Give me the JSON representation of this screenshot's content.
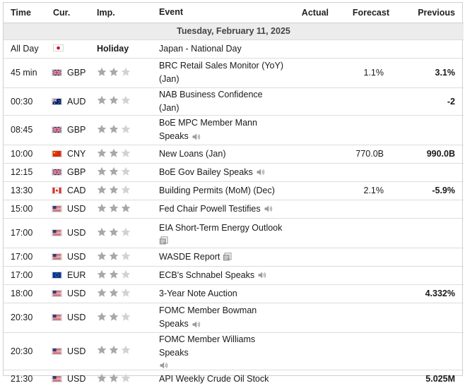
{
  "headers": {
    "time": "Time",
    "cur": "Cur.",
    "imp": "Imp.",
    "event": "Event",
    "actual": "Actual",
    "forecast": "Forecast",
    "previous": "Previous"
  },
  "date": "Tuesday, February 11, 2025",
  "holiday": {
    "time": "All Day",
    "flag": "jp",
    "label": "Holiday",
    "event": "Japan - National Day"
  },
  "colors": {
    "star_on": "#a8a8a8",
    "star_off": "#d2d2d2",
    "border": "#dcdcdc",
    "date_bg": "#ececec"
  },
  "rows": [
    {
      "time": "45 min",
      "flag": "gb",
      "cur": "GBP",
      "stars": 2,
      "event_l1": "BRC Retail Sales Monitor (YoY)",
      "event_l2": "(Jan)",
      "icon": "",
      "actual": "",
      "forecast": "1.1%",
      "previous": "3.1%"
    },
    {
      "time": "00:30",
      "flag": "au",
      "cur": "AUD",
      "stars": 2,
      "event_l1": "NAB Business Confidence (Jan)",
      "event_l2": "",
      "icon": "",
      "actual": "",
      "forecast": "",
      "previous": "-2"
    },
    {
      "time": "08:45",
      "flag": "gb",
      "cur": "GBP",
      "stars": 2,
      "event_l1": "BoE MPC Member Mann",
      "event_l2": "Speaks",
      "icon": "speaker-icon",
      "actual": "",
      "forecast": "",
      "previous": ""
    },
    {
      "time": "10:00",
      "flag": "cn",
      "cur": "CNY",
      "stars": 2,
      "event_l1": "New Loans (Jan)",
      "event_l2": "",
      "icon": "",
      "actual": "",
      "forecast": "770.0B",
      "previous": "990.0B"
    },
    {
      "time": "12:15",
      "flag": "gb",
      "cur": "GBP",
      "stars": 2,
      "event_l1": "BoE Gov Bailey Speaks",
      "event_l2": "",
      "icon": "speaker-icon",
      "actual": "",
      "forecast": "",
      "previous": ""
    },
    {
      "time": "13:30",
      "flag": "ca",
      "cur": "CAD",
      "stars": 2,
      "event_l1": "Building Permits (MoM) (Dec)",
      "event_l2": "",
      "icon": "",
      "actual": "",
      "forecast": "2.1%",
      "previous": "-5.9%"
    },
    {
      "time": "15:00",
      "flag": "us",
      "cur": "USD",
      "stars": 3,
      "event_l1": "Fed Chair Powell Testifies",
      "event_l2": "",
      "icon": "speaker-icon",
      "actual": "",
      "forecast": "",
      "previous": ""
    },
    {
      "time": "17:00",
      "flag": "us",
      "cur": "USD",
      "stars": 2,
      "event_l1": "EIA Short-Term Energy Outlook",
      "event_l2": "",
      "icon": "report-icon",
      "actual": "",
      "forecast": "",
      "previous": ""
    },
    {
      "time": "17:00",
      "flag": "us",
      "cur": "USD",
      "stars": 2,
      "event_l1": "WASDE Report",
      "event_l2": "",
      "icon": "report-icon",
      "actual": "",
      "forecast": "",
      "previous": ""
    },
    {
      "time": "17:00",
      "flag": "eu",
      "cur": "EUR",
      "stars": 2,
      "event_l1": "ECB's Schnabel Speaks",
      "event_l2": "",
      "icon": "speaker-icon",
      "actual": "",
      "forecast": "",
      "previous": ""
    },
    {
      "time": "18:00",
      "flag": "us",
      "cur": "USD",
      "stars": 2,
      "event_l1": "3-Year Note Auction",
      "event_l2": "",
      "icon": "",
      "actual": "",
      "forecast": "",
      "previous": "4.332%"
    },
    {
      "time": "20:30",
      "flag": "us",
      "cur": "USD",
      "stars": 2,
      "event_l1": "FOMC Member Bowman",
      "event_l2": "Speaks",
      "icon": "speaker-icon",
      "actual": "",
      "forecast": "",
      "previous": ""
    },
    {
      "time": "20:30",
      "flag": "us",
      "cur": "USD",
      "stars": 2,
      "event_l1": "FOMC Member Williams Speaks",
      "event_l2": "",
      "icon": "speaker-icon",
      "actual": "",
      "forecast": "",
      "previous": ""
    },
    {
      "time": "21:30",
      "flag": "us",
      "cur": "USD",
      "stars": 2,
      "event_l1": "API Weekly Crude Oil Stock",
      "event_l2": "",
      "icon": "",
      "actual": "",
      "forecast": "",
      "previous": "5.025M"
    }
  ]
}
